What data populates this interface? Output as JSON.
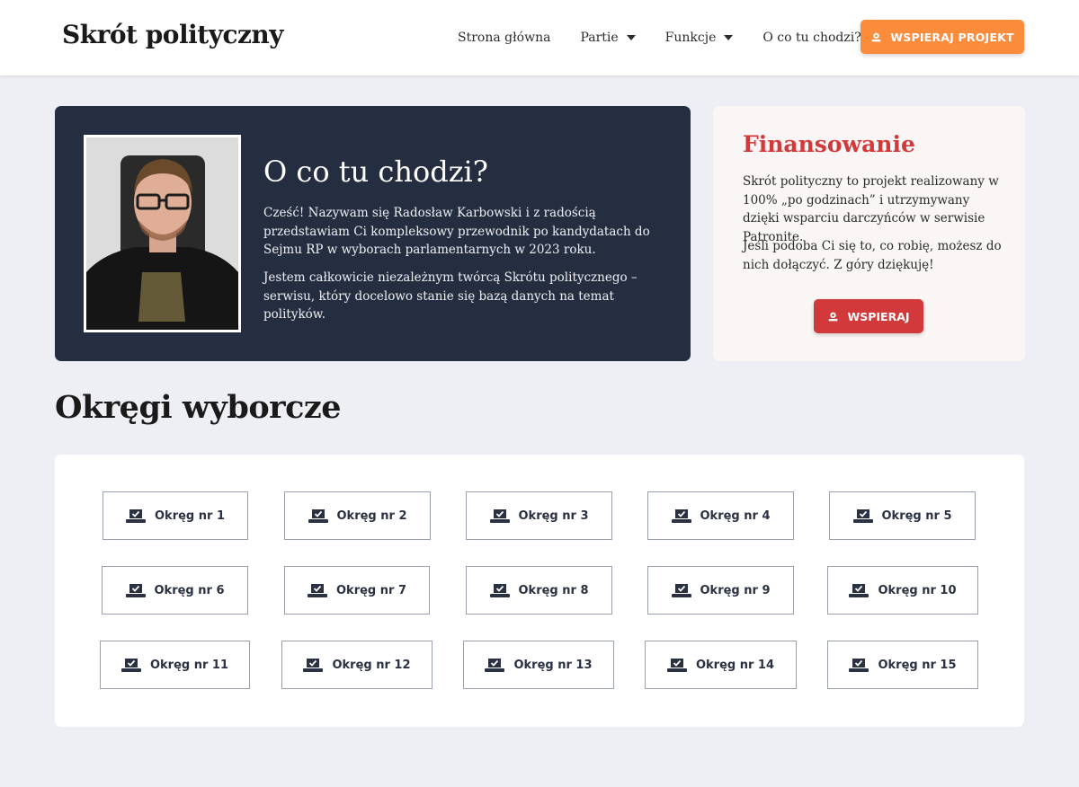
{
  "navbar": {
    "brand": "Skrót polityczny",
    "items": [
      {
        "label": "Strona główna",
        "has_caret": false
      },
      {
        "label": "Partie",
        "has_caret": true
      },
      {
        "label": "Funkcje",
        "has_caret": true
      },
      {
        "label": "O co tu chodzi?",
        "has_caret": false
      }
    ],
    "support_button": {
      "label": "WSPIERAJ PROJEKT",
      "icon": "donate-icon",
      "color": "#fb8c3c"
    }
  },
  "hero": {
    "title": "O co tu chodzi?",
    "paragraphs": [
      "Cześć! Nazywam się Radosław Karbowski i z radością przedstawiam Ci kompleksowy przewodnik po kandydatach do Sejmu RP w wyborach parlamentarnych w 2023 roku.",
      "Jestem całkowicie niezależnym twórcą Skrótu politycznego – serwisu, który docelowo stanie się bazą danych na temat polityków."
    ],
    "background_color": "#252d40"
  },
  "funding": {
    "title": "Finansowanie",
    "paragraphs": [
      "Skrót polityczny to projekt realizowany w 100% „po godzinach” i utrzymywany dzięki wsparciu darczyńców w serwisie Patronite.",
      "Jeśli podoba Ci się to, co robię, możesz do nich dołączyć. Z góry dziękuję!"
    ],
    "button": {
      "label": "WSPIERAJ",
      "icon": "donate-icon",
      "color": "#d2393a"
    }
  },
  "districts": {
    "title": "Okręgi wyborcze",
    "icon": "ballot-box-icon",
    "items": [
      "Okręg nr 1",
      "Okręg nr 2",
      "Okręg nr 3",
      "Okręg nr 4",
      "Okręg nr 5",
      "Okręg nr 6",
      "Okręg nr 7",
      "Okręg nr 8",
      "Okręg nr 9",
      "Okręg nr 10",
      "Okręg nr 11",
      "Okręg nr 12",
      "Okręg nr 13",
      "Okręg nr 14",
      "Okręg nr 15"
    ]
  }
}
